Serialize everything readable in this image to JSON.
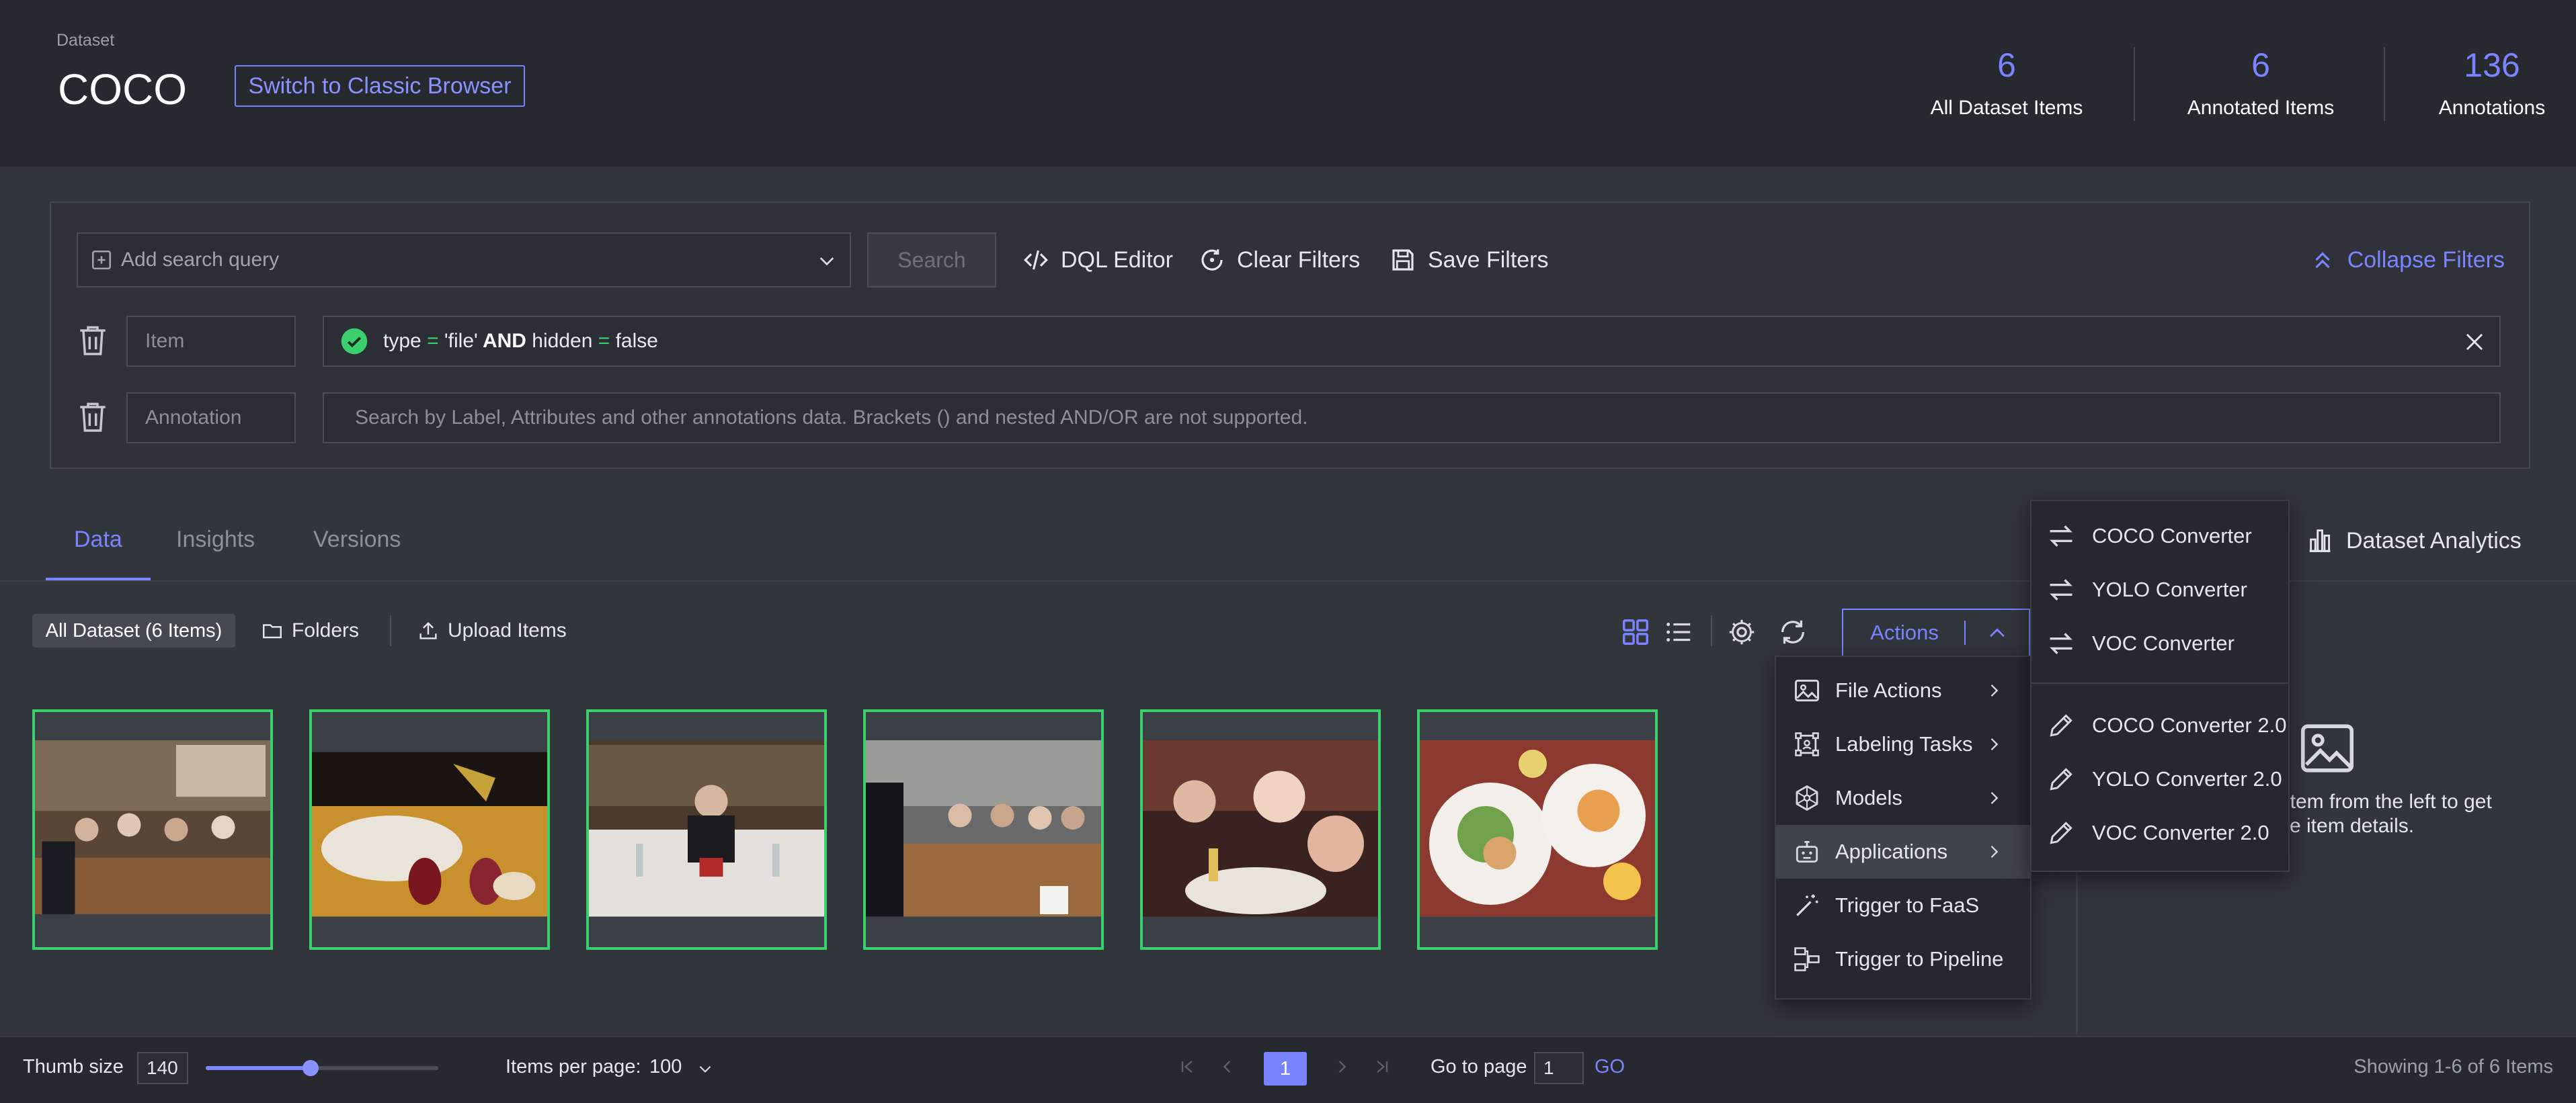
{
  "header": {
    "breadcrumb": "Dataset",
    "title": "COCO",
    "switch_button": "Switch to Classic Browser",
    "stats": [
      {
        "value": "6",
        "label": "All Dataset Items"
      },
      {
        "value": "6",
        "label": "Annotated Items"
      },
      {
        "value": "136",
        "label": "Annotations"
      }
    ]
  },
  "filters": {
    "search_placeholder": "Add search query",
    "search_button": "Search",
    "dql_editor": "DQL Editor",
    "clear_filters": "Clear Filters",
    "save_filters": "Save Filters",
    "collapse_filters": "Collapse Filters",
    "item_label": "Item",
    "item_query": {
      "t1": "type",
      "eq1": " = ",
      "v1": "'file'",
      "and": " AND ",
      "t2": "hidden",
      "eq2": " = ",
      "v2": "false"
    },
    "annotation_label": "Annotation",
    "annotation_placeholder": "Search by Label, Attributes and other annotations data. Brackets () and nested AND/OR are not supported."
  },
  "tabs": [
    {
      "label": "Data",
      "active": true
    },
    {
      "label": "Insights",
      "active": false
    },
    {
      "label": "Versions",
      "active": false
    }
  ],
  "dataset_analytics": "Dataset Analytics",
  "toolbar": {
    "scope_chip": "All Dataset (6 Items)",
    "folders": "Folders",
    "upload": "Upload Items",
    "actions": "Actions"
  },
  "actions_menu": [
    {
      "label": "File Actions",
      "icon": "image-icon",
      "submenu": true
    },
    {
      "label": "Labeling Tasks",
      "icon": "labeling-icon",
      "submenu": true
    },
    {
      "label": "Models",
      "icon": "model-icon",
      "submenu": true
    },
    {
      "label": "Applications",
      "icon": "robot-icon",
      "submenu": true
    },
    {
      "label": "Trigger to FaaS",
      "icon": "magic-wand-icon",
      "submenu": false
    },
    {
      "label": "Trigger to Pipeline",
      "icon": "pipeline-icon",
      "submenu": false
    }
  ],
  "applications_submenu": [
    {
      "label": "COCO Converter",
      "icon": "swap-icon"
    },
    {
      "label": "YOLO Converter",
      "icon": "swap-icon"
    },
    {
      "label": "VOC Converter",
      "icon": "swap-icon"
    },
    {
      "label": "COCO Converter 2.0",
      "icon": "pencil-icon"
    },
    {
      "label": "YOLO Converter 2.0",
      "icon": "pencil-icon"
    },
    {
      "label": "VOC Converter 2.0",
      "icon": "pencil-icon"
    }
  ],
  "details_panel": {
    "line1": "item from the left to get",
    "line2": "e item details."
  },
  "footer": {
    "thumb_size_label": "Thumb size",
    "thumb_size_value": "140",
    "items_per_page_label": "Items per page:",
    "items_per_page_value": "100",
    "current_page": "1",
    "go_to_page_label": "Go to page",
    "go_to_page_value": "1",
    "go_button": "GO",
    "showing": "Showing 1-6 of 6 Items"
  },
  "colors": {
    "accent": "#7b84ff",
    "selected_border": "#3ccf6e",
    "success": "#3ccf6e"
  }
}
